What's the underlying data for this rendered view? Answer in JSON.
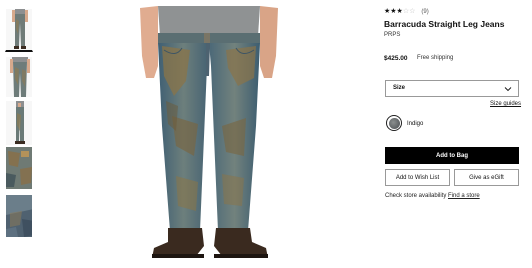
{
  "product": {
    "rating": 3.5,
    "rating_max": 5,
    "review_count": "(9)",
    "title": "Barracuda Straight Leg Jeans",
    "brand": "PRPS",
    "price": "$425.00",
    "shipping": "Free shipping"
  },
  "size": {
    "label": "Size",
    "guides_link": "Size guides"
  },
  "color": {
    "name": "Indigo",
    "swatch_hex": "#6b6f71"
  },
  "actions": {
    "add_to_bag": "Add to Bag",
    "wish_list": "Add to Wish List",
    "egift": "Give as eGift"
  },
  "store": {
    "availability_label": "Check store availability",
    "find_store_link": "Find a store"
  },
  "thumbnails": [
    {
      "name": "front-view",
      "active": true
    },
    {
      "name": "front-crop-view",
      "active": false
    },
    {
      "name": "side-view",
      "active": false
    },
    {
      "name": "back-detail-view",
      "active": false
    },
    {
      "name": "fabric-detail-view",
      "active": false
    }
  ],
  "icons": {
    "size_dropdown": "chevron-down-icon"
  },
  "colors": {
    "accent": "#000000",
    "border": "#999999"
  }
}
